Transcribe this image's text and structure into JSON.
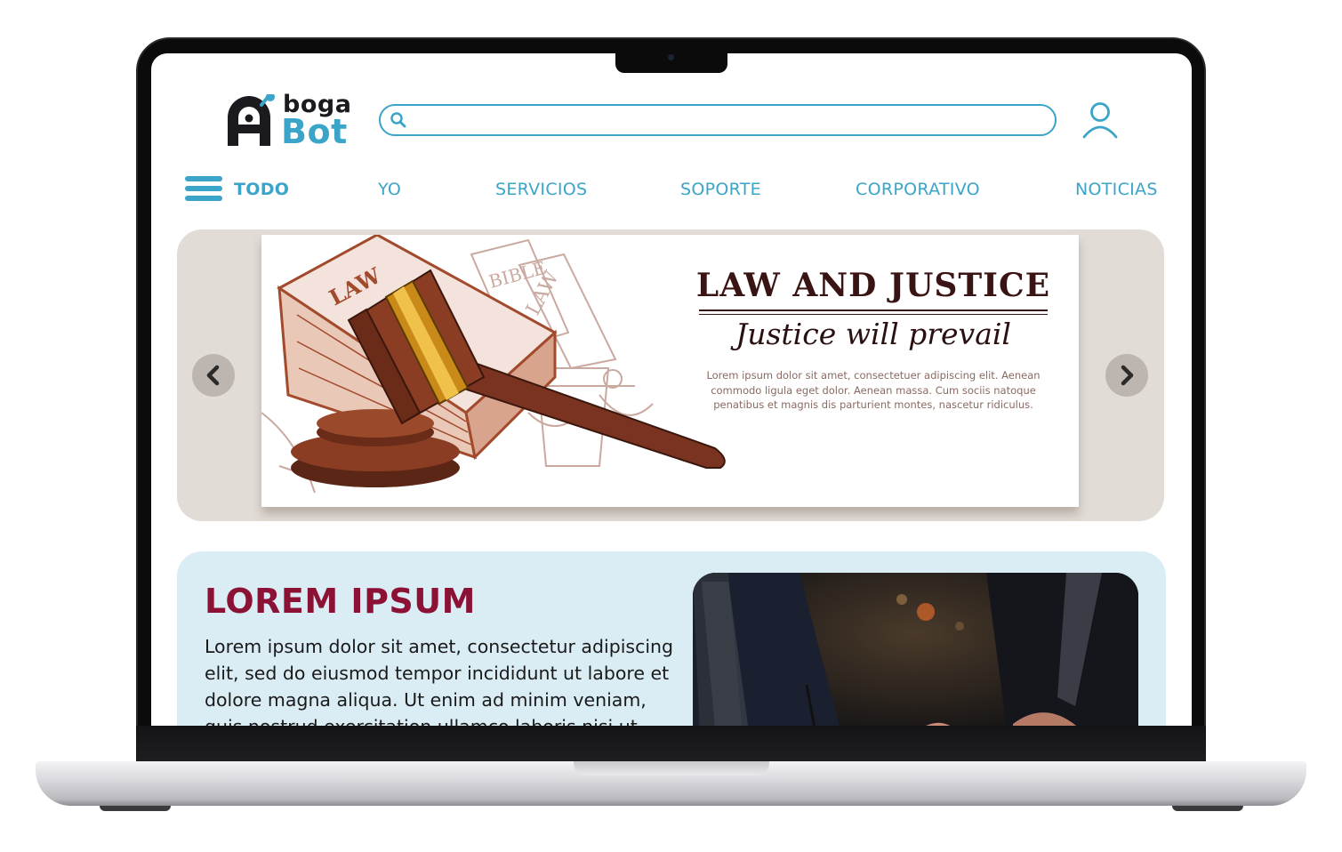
{
  "brand": {
    "logo_top": "boga",
    "logo_bottom": "Bot",
    "primary_color": "#3aa4c9",
    "dark_color": "#1b1b1f"
  },
  "search": {
    "value": "",
    "placeholder": ""
  },
  "nav": {
    "items": [
      {
        "label": "TODO"
      },
      {
        "label": "YO"
      },
      {
        "label": "SERVICIOS"
      },
      {
        "label": "SOPORTE"
      },
      {
        "label": "CORPORATIVO"
      },
      {
        "label": "NOTICIAS"
      }
    ]
  },
  "carousel": {
    "banner_title": "LAW AND JUSTICE",
    "banner_subtitle": "Justice will prevail",
    "banner_body": "Lorem ipsum dolor sit amet, consectetuer adipiscing elit. Aenean commodo ligula eget dolor. Aenean massa. Cum sociis natoque penatibus et magnis dis parturient montes, nascetur ridiculus.",
    "book_label_1": "LAW",
    "book_label_2": "BIBLE",
    "book_label_3": "LAW",
    "background_color": "#e2dcd6"
  },
  "feature": {
    "title": "LOREM IPSUM",
    "body": "Lorem ipsum dolor sit amet, consectetur adipiscing elit, sed do eiusmod tempor incididunt ut labore et dolore magna aliqua. Ut enim ad minim veniam, quis nostrud exercitation ullamco laboris nisi ut",
    "title_color": "#8b1235",
    "background_color": "#daedf4"
  },
  "icons": {
    "search": "search-icon",
    "user": "user-icon",
    "menu": "hamburger-menu-icon",
    "prev": "chevron-left-icon",
    "next": "chevron-right-icon"
  }
}
